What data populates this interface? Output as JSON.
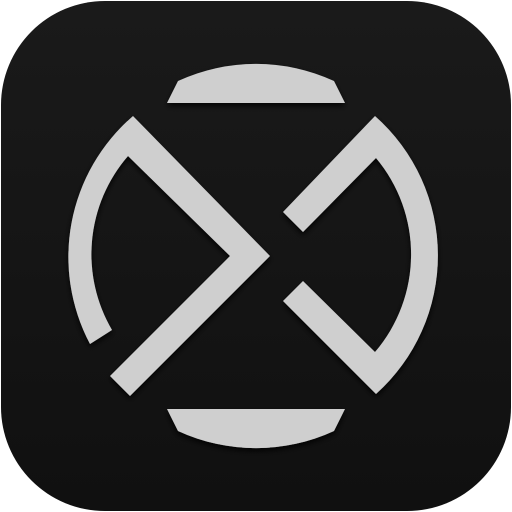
{
  "icon": {
    "name": "app-logo-icon",
    "colors": {
      "background": "#101010",
      "background_edge": "#1a1a1a",
      "mark": "#cfcfcf",
      "mark_shadow": "#000000"
    }
  }
}
